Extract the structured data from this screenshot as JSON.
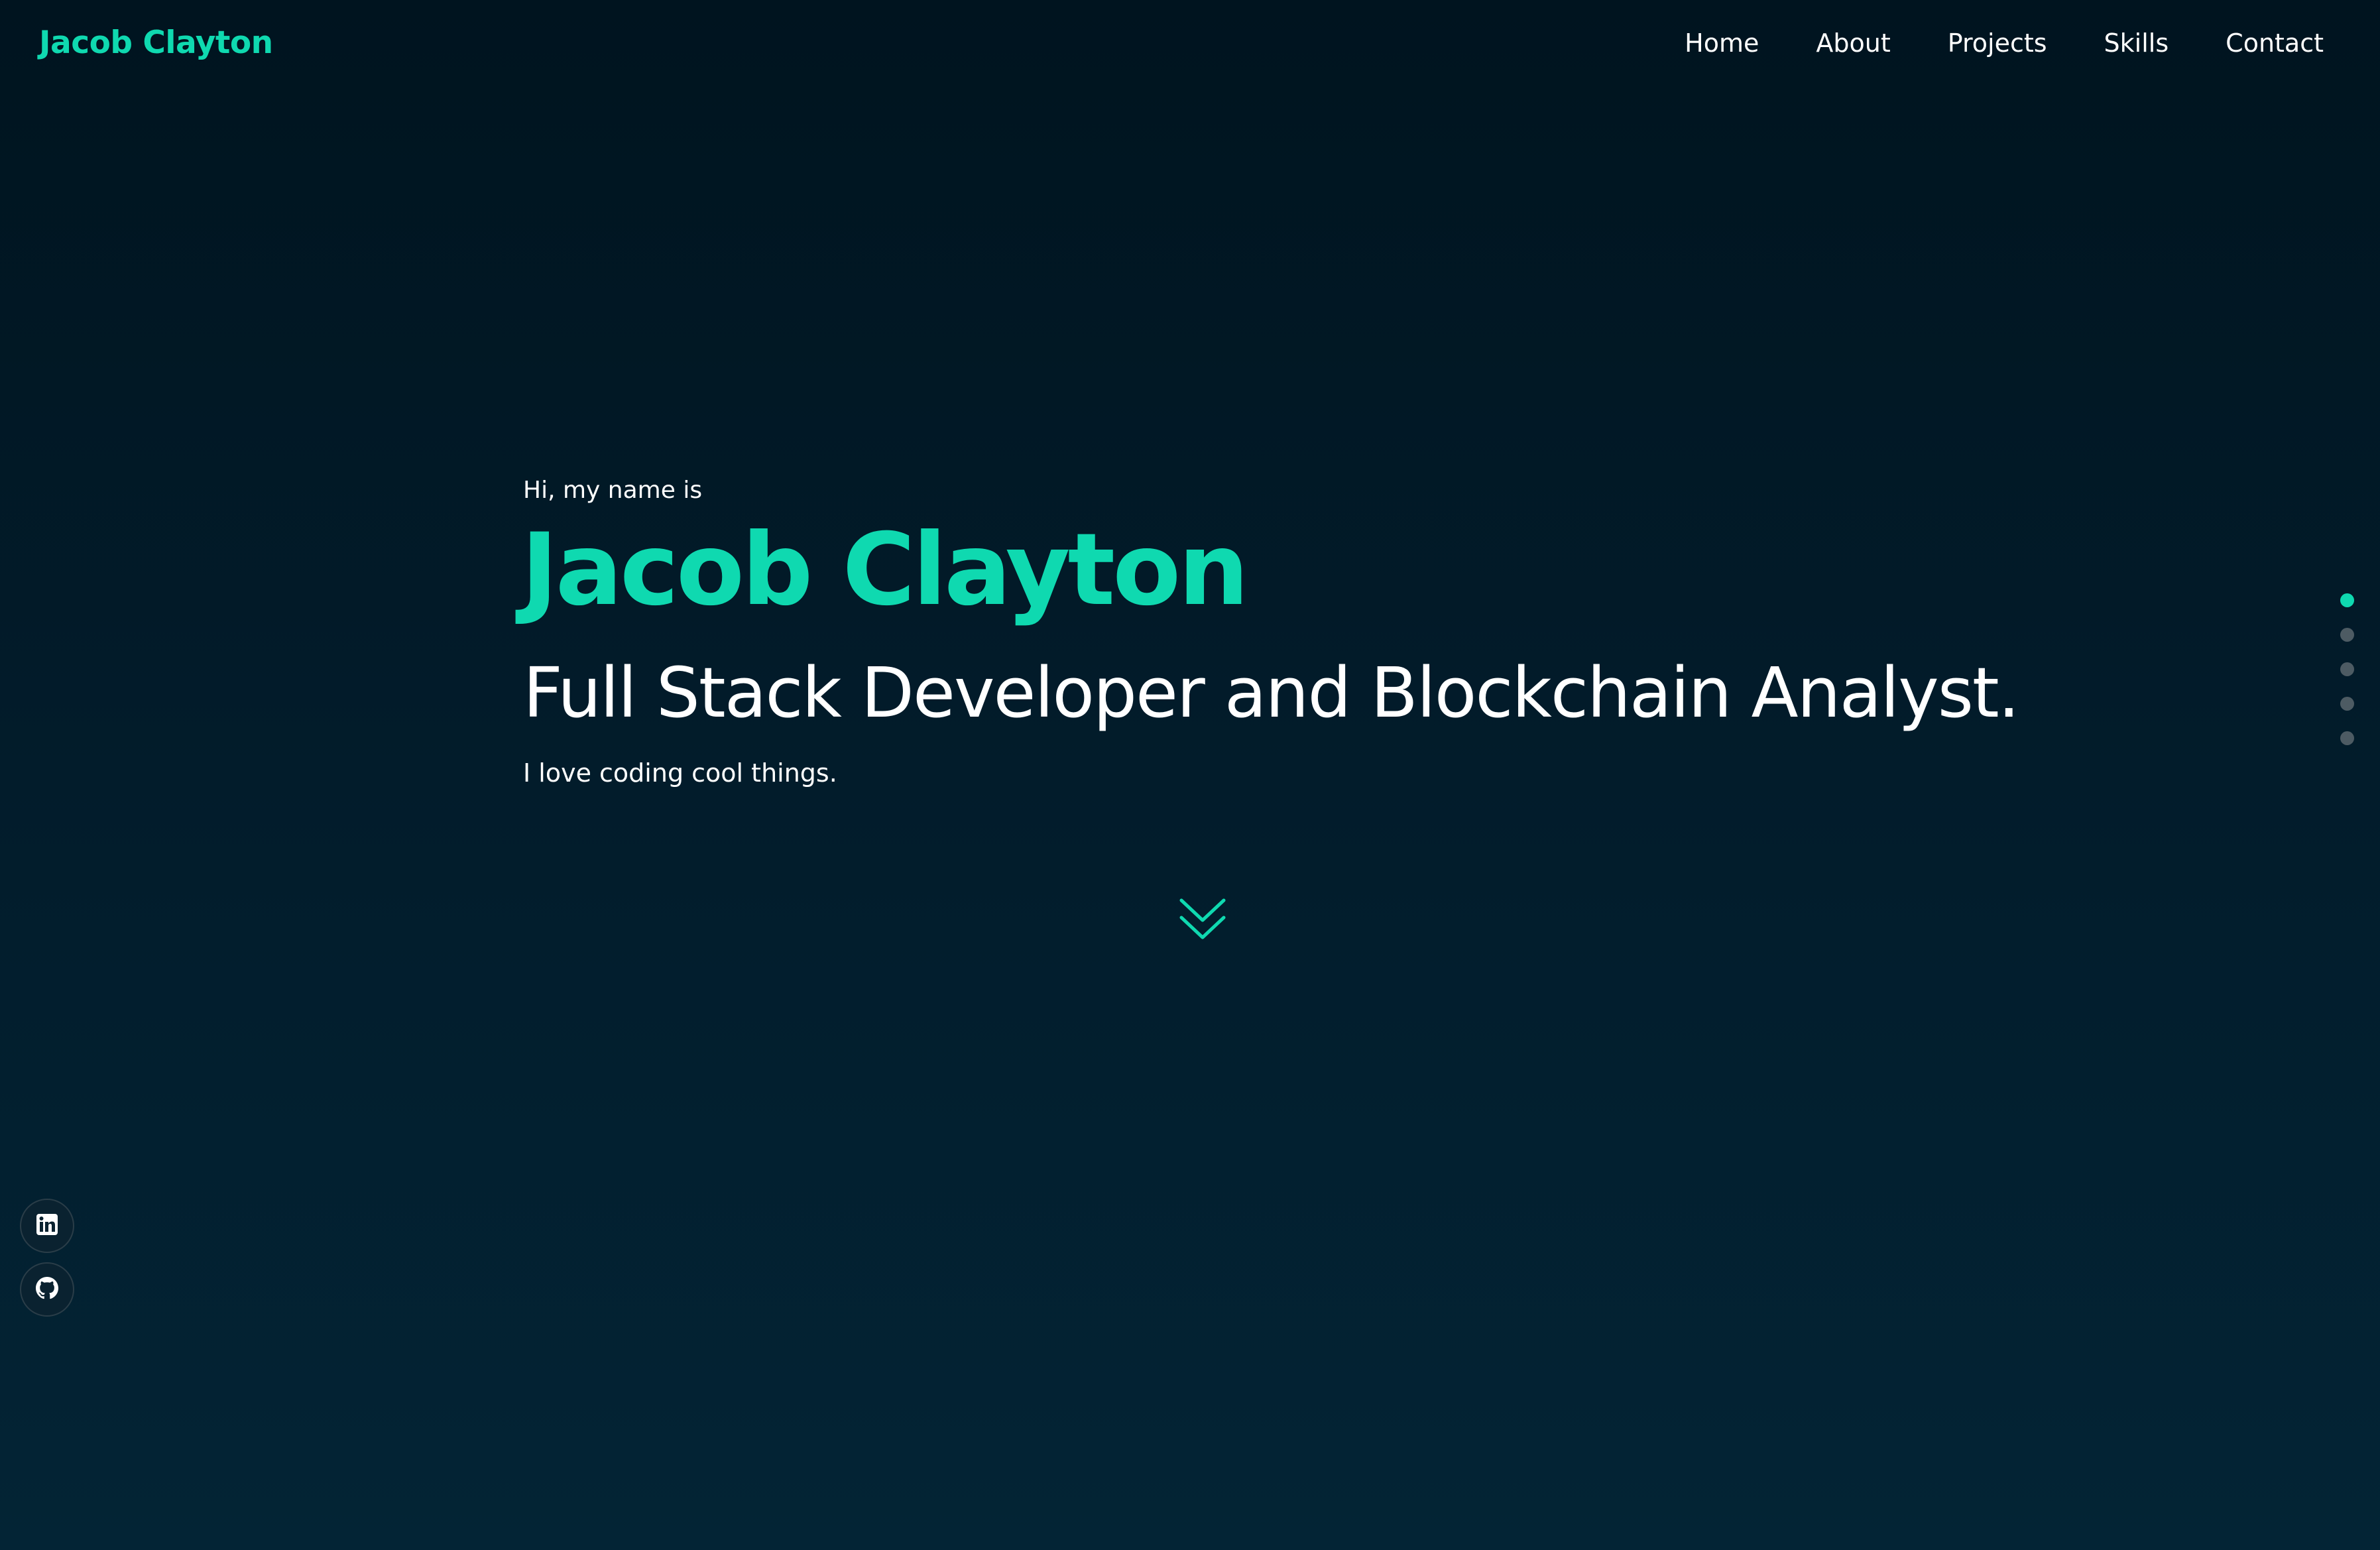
{
  "header": {
    "brand": "Jacob Clayton",
    "nav": [
      "Home",
      "About",
      "Projects",
      "Skills",
      "Contact"
    ]
  },
  "hero": {
    "greeting": "Hi, my name is",
    "name": "Jacob Clayton",
    "role": "Full Stack Developer and Blockchain Analyst.",
    "tagline": "I love coding cool things."
  },
  "section_dots": {
    "count": 5,
    "active_index": 0
  },
  "social": [
    {
      "icon": "linkedin-icon"
    },
    {
      "icon": "github-icon"
    }
  ],
  "scroll_icon": "double-chevron-down-icon",
  "colors": {
    "accent": "#0fd9b0",
    "background_top": "#00141f",
    "background_bottom": "#032435",
    "dot_inactive": "#4d5b63"
  }
}
